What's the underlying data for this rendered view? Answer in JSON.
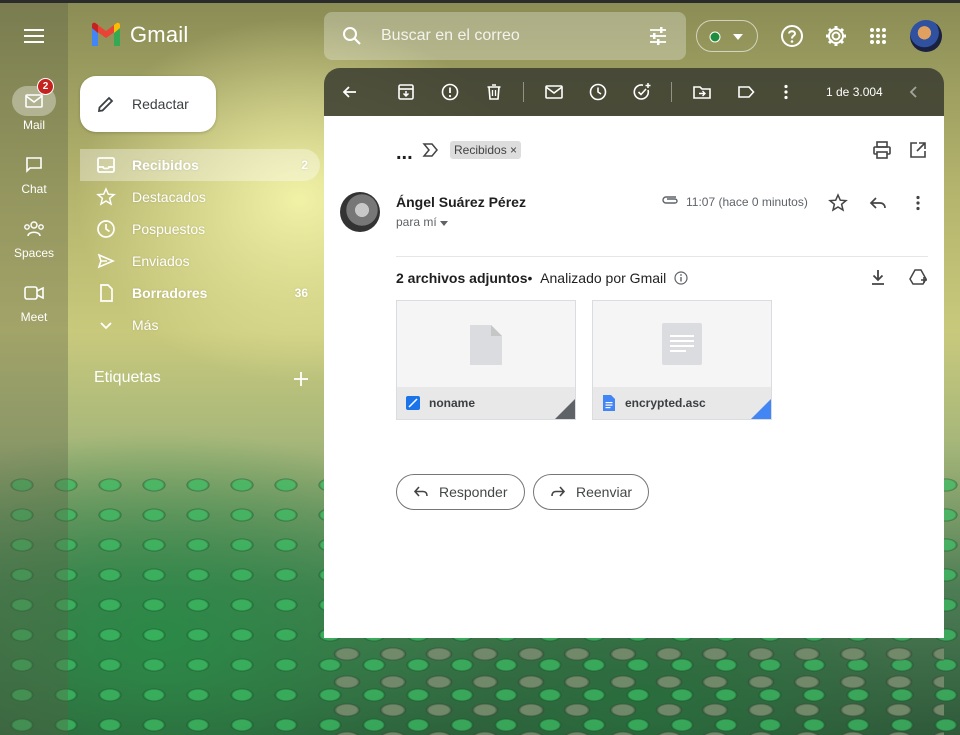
{
  "app": {
    "name": "Gmail"
  },
  "rail": [
    {
      "label": "Mail",
      "badge": "2",
      "icon": "mail-icon"
    },
    {
      "label": "Chat",
      "icon": "chat-icon"
    },
    {
      "label": "Spaces",
      "icon": "spaces-icon"
    },
    {
      "label": "Meet",
      "icon": "meet-icon"
    }
  ],
  "search": {
    "placeholder": "Buscar en el correo"
  },
  "compose": {
    "label": "Redactar"
  },
  "nav": [
    {
      "label": "Recibidos",
      "count": "2",
      "icon": "inbox-icon"
    },
    {
      "label": "Destacados",
      "icon": "star-icon"
    },
    {
      "label": "Pospuestos",
      "icon": "clock-icon"
    },
    {
      "label": "Enviados",
      "icon": "send-icon"
    },
    {
      "label": "Borradores",
      "count": "36",
      "icon": "draft-icon"
    },
    {
      "label": "Más",
      "icon": "chevron-down-icon"
    }
  ],
  "labels": {
    "title": "Etiquetas"
  },
  "toolbar": {
    "pager": "1 de 3.004"
  },
  "message": {
    "subject": "...",
    "chip": "Recibidos",
    "chip_close": "×",
    "sender": "Ángel Suárez Pérez",
    "to": "para mí",
    "time": "11:07 (hace 0 minutos)"
  },
  "attachments": {
    "title": "2 archivos adjuntos",
    "separator": "•",
    "scanned": "Analizado por Gmail",
    "items": [
      {
        "name": "noname",
        "fold_color": "#5f6368",
        "icon_color": "#1a73e8"
      },
      {
        "name": "encrypted.asc",
        "fold_color": "#4285f4",
        "icon_color": "#4285f4"
      }
    ]
  },
  "actions": {
    "reply": "Responder",
    "forward": "Reenviar"
  },
  "colors": {
    "status_dot": "#1e8e3e",
    "badge": "#c5221f"
  }
}
